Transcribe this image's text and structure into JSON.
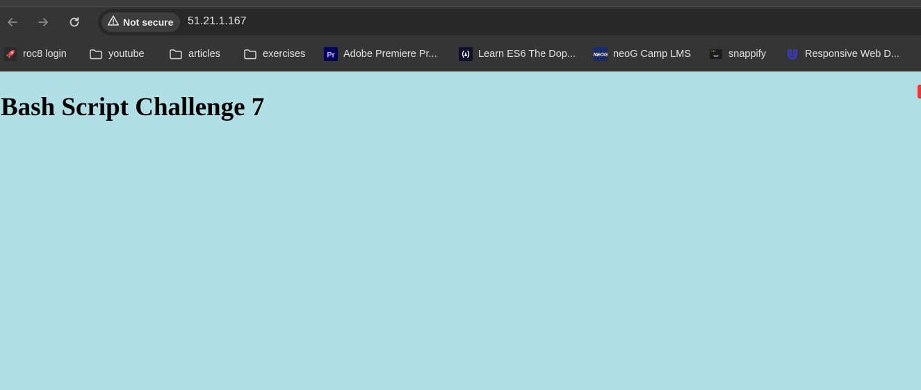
{
  "browser": {
    "security_chip": {
      "label": "Not secure",
      "icon": "warning-triangle-icon"
    },
    "url": "51.21.1.167"
  },
  "bookmarks": [
    {
      "label": "roc8 login",
      "icon": "rocket-icon"
    },
    {
      "label": "youtube",
      "icon": "folder-icon"
    },
    {
      "label": "articles",
      "icon": "folder-icon"
    },
    {
      "label": "exercises",
      "icon": "folder-icon"
    },
    {
      "label": "Adobe Premiere Pr...",
      "icon": "premiere-pro-icon"
    },
    {
      "label": "Learn ES6 The Dop...",
      "icon": "es6-icon"
    },
    {
      "label": "neoG Camp LMS",
      "icon": "neog-icon"
    },
    {
      "label": "snappify",
      "icon": "snappify-icon"
    },
    {
      "label": "Responsive Web D...",
      "icon": "udacity-icon"
    }
  ],
  "page": {
    "heading": "Bash Script Challenge 7",
    "background": "#b0dfe5"
  }
}
